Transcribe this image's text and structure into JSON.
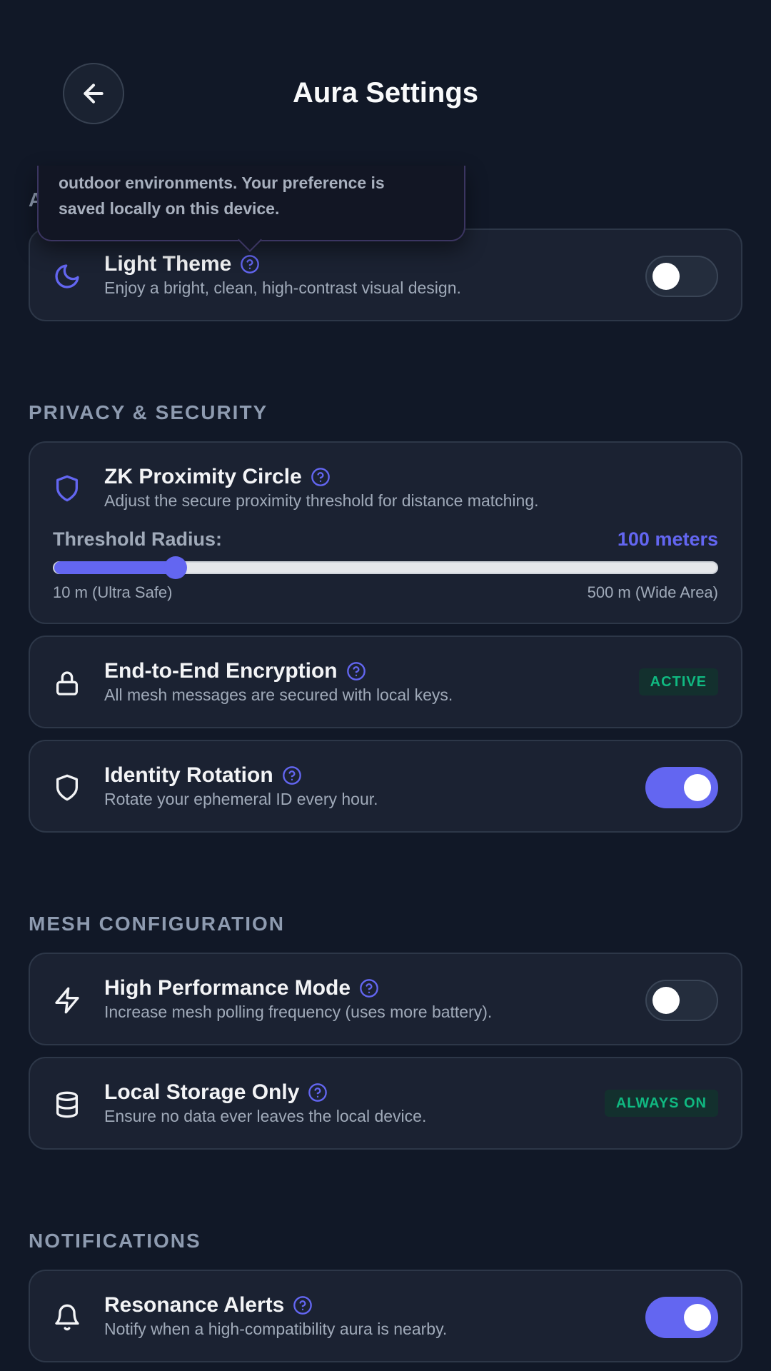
{
  "header": {
    "title": "Aura Settings"
  },
  "sections": {
    "appearance": {
      "label_partial": "A"
    },
    "privacy": {
      "label": "PRIVACY & SECURITY"
    },
    "mesh": {
      "label": "MESH CONFIGURATION"
    },
    "notifications": {
      "label": "NOTIFICATIONS"
    }
  },
  "tooltip": {
    "line_partial": "outdoor environments. Your preference is",
    "line_last": "saved locally on this device."
  },
  "light_theme": {
    "title": "Light Theme",
    "subtitle": "Enjoy a bright, clean, high-contrast visual design.",
    "enabled": false,
    "icon": "moon-icon"
  },
  "zk_proximity": {
    "title": "ZK Proximity Circle",
    "subtitle": "Adjust the secure proximity threshold for distance matching.",
    "slider_label": "Threshold Radius:",
    "value_display": "100 meters",
    "value": 100,
    "min": 10,
    "max": 500,
    "min_label": "10 m (Ultra Safe)",
    "max_label": "500 m (Wide Area)",
    "icon": "shield-icon"
  },
  "encryption": {
    "title": "End-to-End Encryption",
    "subtitle": "All mesh messages are secured with local keys.",
    "badge": "ACTIVE",
    "icon": "lock-icon"
  },
  "identity_rotation": {
    "title": "Identity Rotation",
    "subtitle": "Rotate your ephemeral ID every hour.",
    "enabled": true,
    "icon": "shield-icon"
  },
  "high_performance": {
    "title": "High Performance Mode",
    "subtitle": "Increase mesh polling frequency (uses more battery).",
    "enabled": false,
    "icon": "lightning-icon"
  },
  "local_storage": {
    "title": "Local Storage Only",
    "subtitle": "Ensure no data ever leaves the local device.",
    "badge": "ALWAYS ON",
    "icon": "database-icon"
  },
  "resonance_alerts": {
    "title": "Resonance Alerts",
    "subtitle": "Notify when a high-compatibility aura is nearby.",
    "enabled": true,
    "icon": "bell-icon"
  },
  "colors": {
    "background": "#111827",
    "card": "#1b2232",
    "accent": "#6366f1",
    "badge_green": "#10b981"
  }
}
